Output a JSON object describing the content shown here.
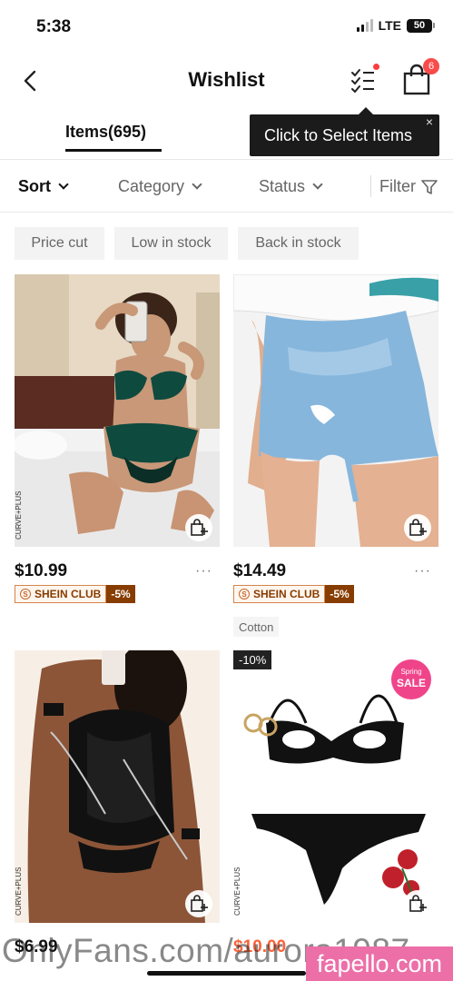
{
  "status_bar": {
    "time": "5:38",
    "network": "LTE",
    "battery": "50"
  },
  "header": {
    "title": "Wishlist",
    "cart_count": "6"
  },
  "tabs": {
    "items_label": "Items(695)"
  },
  "tooltip": {
    "text": "Click to Select Items",
    "close": "×"
  },
  "sort_bar": {
    "sort": "Sort",
    "category": "Category",
    "status": "Status",
    "filter": "Filter"
  },
  "chips": [
    "Price cut",
    "Low in stock",
    "Back in stock"
  ],
  "products": [
    {
      "price": "$10.99",
      "club_label": "SHEIN CLUB",
      "club_discount": "-5%",
      "brand": "CURVE+PLUS",
      "more": "···"
    },
    {
      "price": "$14.49",
      "club_label": "SHEIN CLUB",
      "club_discount": "-5%",
      "tag": "Cotton",
      "more": "···"
    },
    {
      "price": "$6.99",
      "brand": "CURVE+PLUS"
    },
    {
      "price": "$10.00",
      "discount": "-10%",
      "badge_small": "Spring",
      "badge_big": "SALE",
      "brand": "CURVE+PLUS"
    }
  ],
  "watermarks": {
    "onlyfans": "OnlyFans.com/aurora1987",
    "fapello": "fapello.com"
  },
  "colors": {
    "accent_red": "#fa3d3d",
    "club_brown": "#873c00",
    "sale_orange": "#fa6338"
  }
}
